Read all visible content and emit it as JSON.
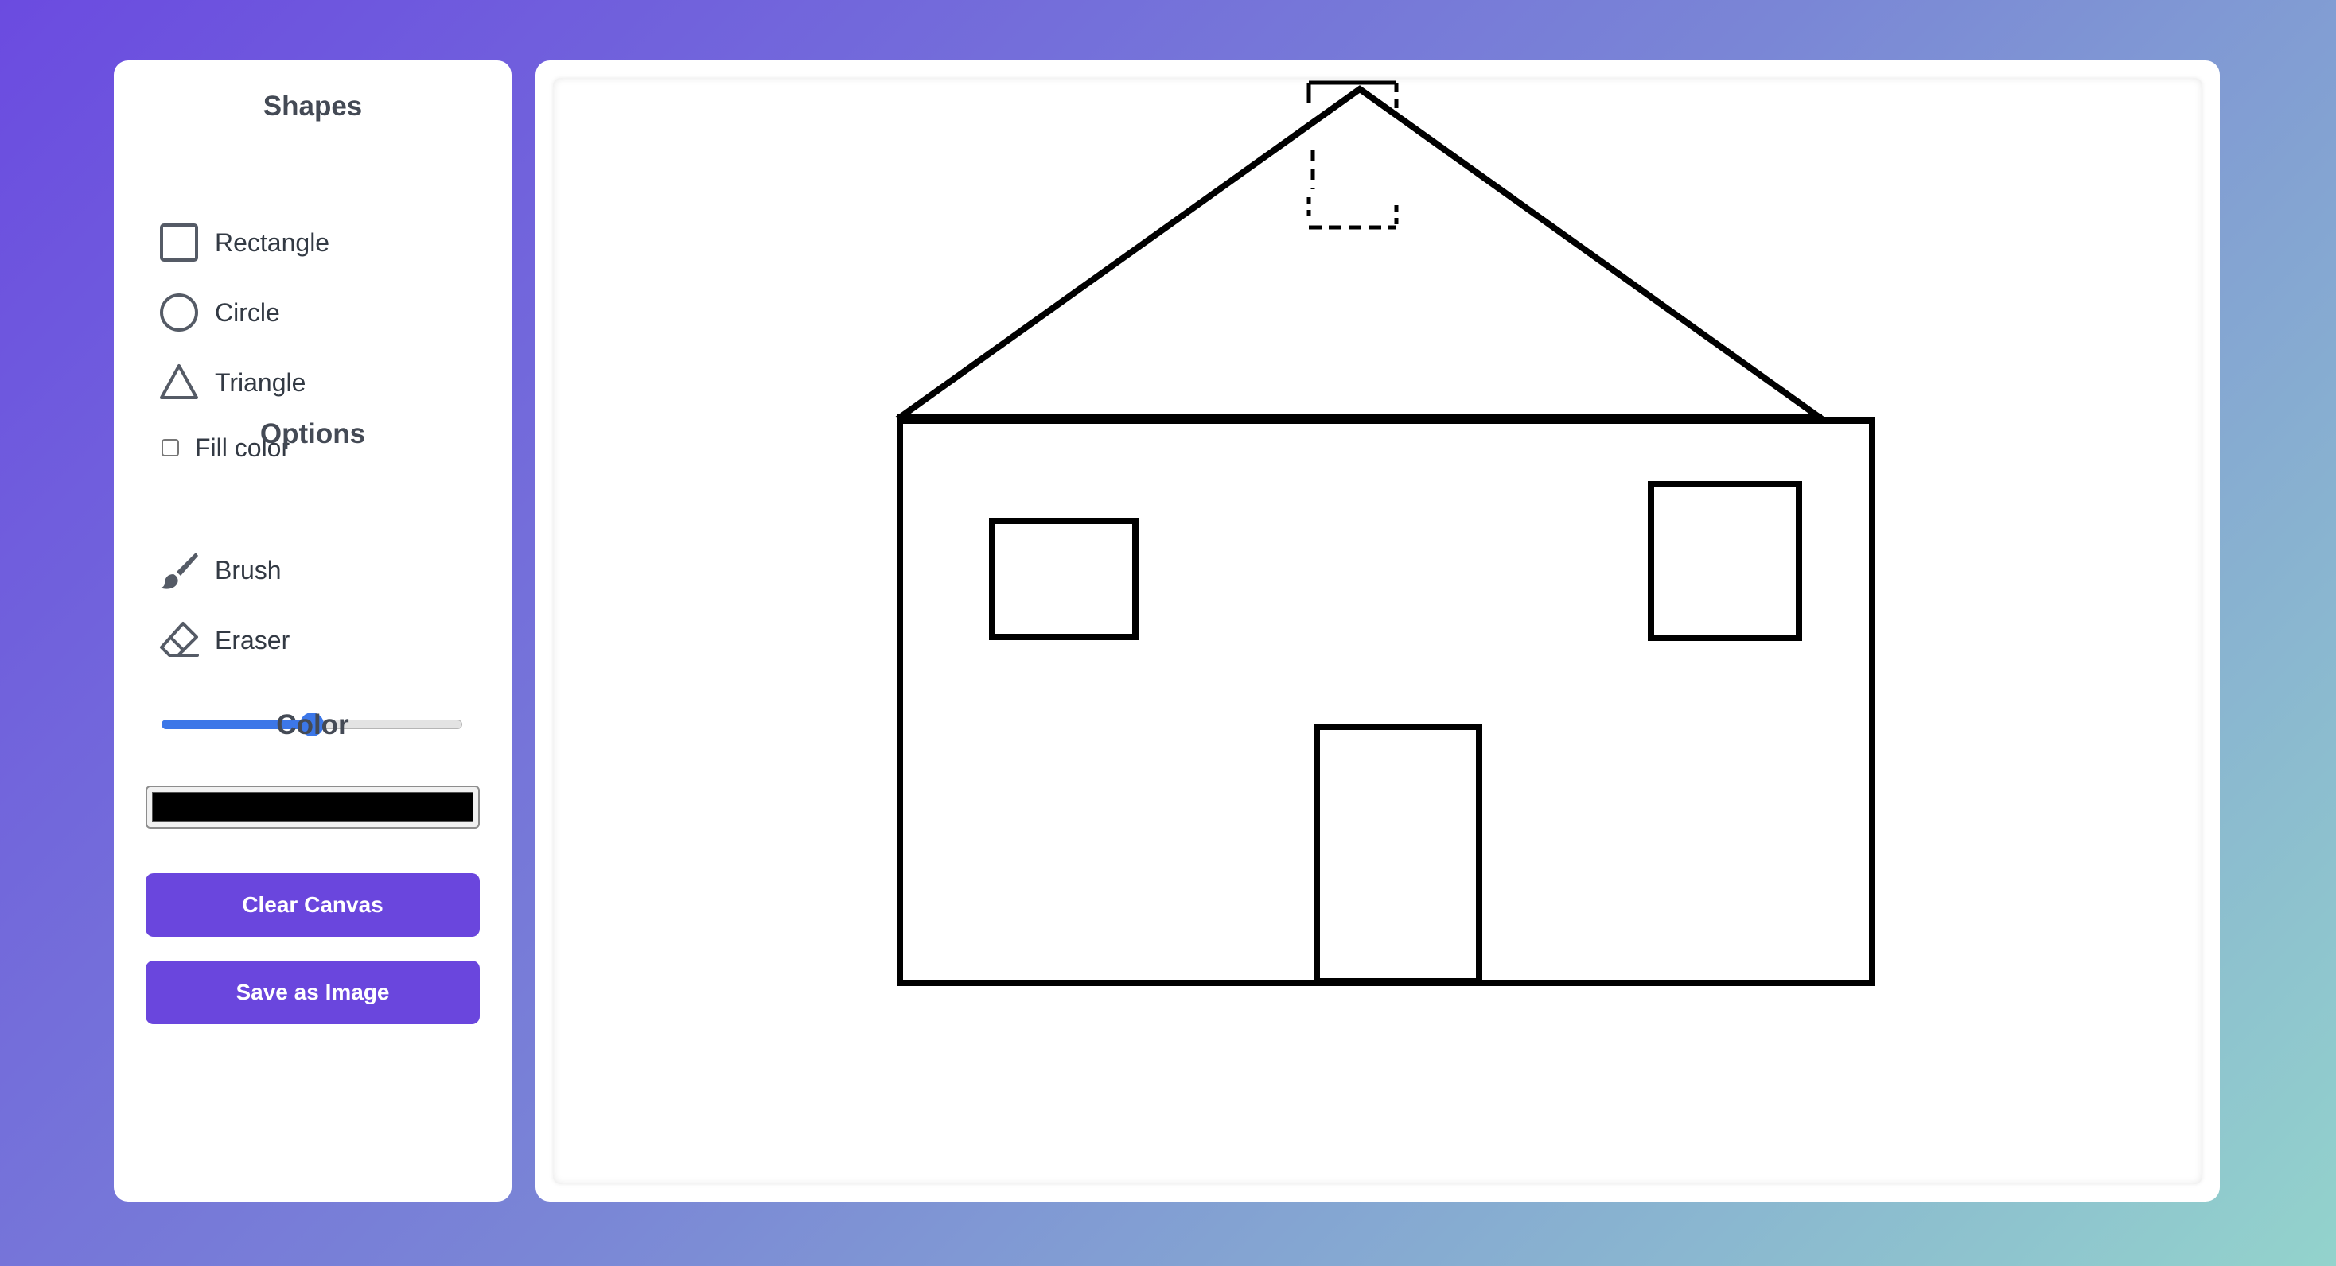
{
  "sidebar": {
    "shapes_title": "Shapes",
    "shapes": [
      {
        "label": "Rectangle",
        "icon": "square-outline-icon"
      },
      {
        "label": "Circle",
        "icon": "circle-outline-icon"
      },
      {
        "label": "Triangle",
        "icon": "triangle-outline-icon"
      }
    ],
    "fill_color_label": "Fill color",
    "fill_color_checked": false,
    "options_title": "Options",
    "options": [
      {
        "label": "Brush",
        "icon": "brush-icon"
      },
      {
        "label": "Eraser",
        "icon": "eraser-icon"
      }
    ],
    "brush_size_fraction": 0.5,
    "color_title": "Color",
    "selected_color": "#000000",
    "clear_button": "Clear Canvas",
    "save_button": "Save as Image"
  },
  "colors": {
    "button": "#6a46dd",
    "slider_accent": "#3c77e8",
    "icon": "#555b66"
  },
  "canvas": {
    "drawing": "house",
    "stroke_color": "#000000"
  }
}
